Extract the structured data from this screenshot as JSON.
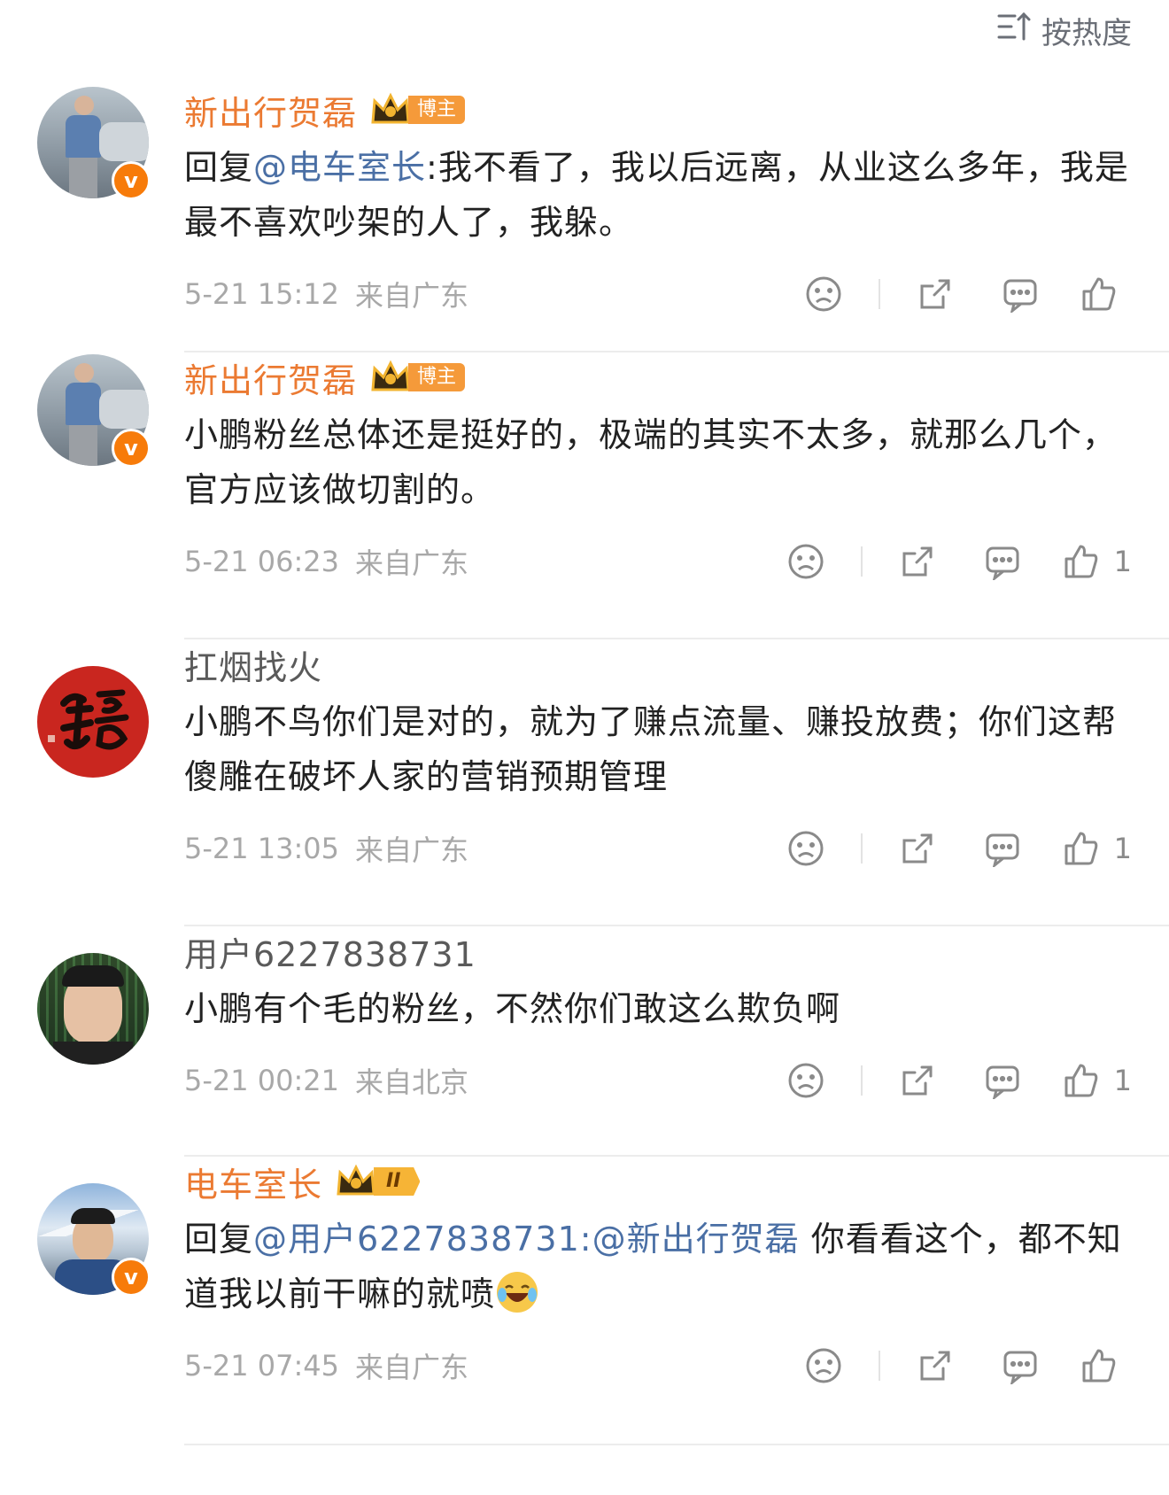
{
  "sort": {
    "label": "按热度",
    "icon": "sort-icon"
  },
  "comments": [
    {
      "name": "新出行贺磊",
      "badge": "博主",
      "verified_mark": "v",
      "reply_prefix": "回复",
      "mention": "@电车室长",
      "text": ":我不看了，我以后远离，从业这么多年，我是最不喜欢吵架的人了，我躲。",
      "time": "5-21 15:12",
      "location": "来自广东",
      "likes": ""
    },
    {
      "name": "新出行贺磊",
      "badge": "博主",
      "verified_mark": "v",
      "text": "小鹏粉丝总体还是挺好的，极端的其实不太多，就那么几个，官方应该做切割的。",
      "time": "5-21 06:23",
      "location": "来自广东",
      "likes": "1"
    },
    {
      "name": "扛烟找火",
      "text": "小鹏不鸟你们是对的，就为了赚点流量、赚投放费；你们这帮傻雕在破坏人家的营销预期管理",
      "time": "5-21 13:05",
      "location": "来自广东",
      "likes": "1"
    },
    {
      "name": "用户6227838731",
      "text": "小鹏有个毛的粉丝，不然你们敢这么欺负啊",
      "time": "5-21 00:21",
      "location": "来自北京",
      "likes": "1"
    },
    {
      "name": "电车室长",
      "level_badge": "II",
      "verified_mark": "v",
      "reply_prefix": "回复",
      "mention": "@用户6227838731",
      "mention2": ":@新出行贺磊",
      "text": " 你看看这个，都不知道我以前干嘛的就喷",
      "emoji": "laughing-tears-emoji",
      "time": "5-21 07:45",
      "location": "来自广东",
      "likes": ""
    }
  ],
  "colors": {
    "vip_name": "#eb7a32",
    "mention": "#4a6fa5",
    "meta": "#a8a8a8",
    "verified": "#f77b0a"
  }
}
